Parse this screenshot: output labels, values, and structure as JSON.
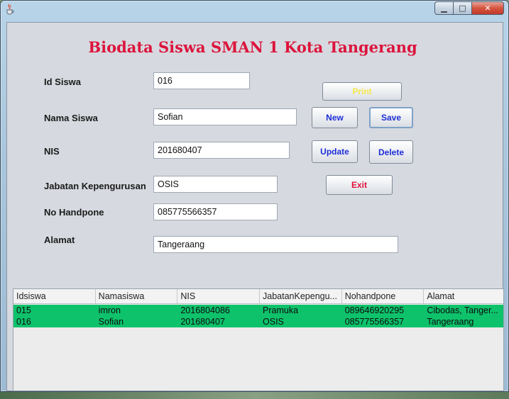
{
  "window": {
    "minimize_glyph": "▁",
    "maximize_glyph": "□",
    "close_glyph": "✕",
    "title_icon": "java-icon"
  },
  "form": {
    "title": "Biodata Siswa SMAN 1 Kota Tangerang",
    "fields": {
      "id_siswa": {
        "label": "Id Siswa",
        "value": "016"
      },
      "nama_siswa": {
        "label": "Nama Siswa",
        "value": "Sofian"
      },
      "nis": {
        "label": "NIS",
        "value": "201680407"
      },
      "jabatan": {
        "label": "Jabatan Kepengurusan",
        "value": "OSIS"
      },
      "no_handpone": {
        "label": "No Handpone",
        "value": "085775566357"
      },
      "alamat": {
        "label": "Alamat",
        "value": "Tangeraang"
      }
    },
    "buttons": {
      "print": "Print",
      "new": "New",
      "save": "Save",
      "update": "Update",
      "delete": "Delete",
      "exit": "Exit"
    }
  },
  "table": {
    "columns": [
      "Idsiswa",
      "Namasiswa",
      "NIS",
      "JabatanKepengu...",
      "Nohandpone",
      "Alamat"
    ],
    "rows": [
      [
        "015",
        "imron",
        "2016804086",
        "Pramuka",
        "089646920295",
        "Cibodas, Tanger..."
      ],
      [
        "016",
        "Sofian",
        "201680407",
        "OSIS",
        "085775566357",
        "Tangeraang"
      ]
    ]
  },
  "colors": {
    "title": "#dc143c",
    "button_text_blue": "#1e2fd6",
    "button_text_red": "#e0123a",
    "button_text_print": "#f2e84a",
    "row_highlight": "#0ec26b",
    "panel_background": "#d6d9df"
  }
}
